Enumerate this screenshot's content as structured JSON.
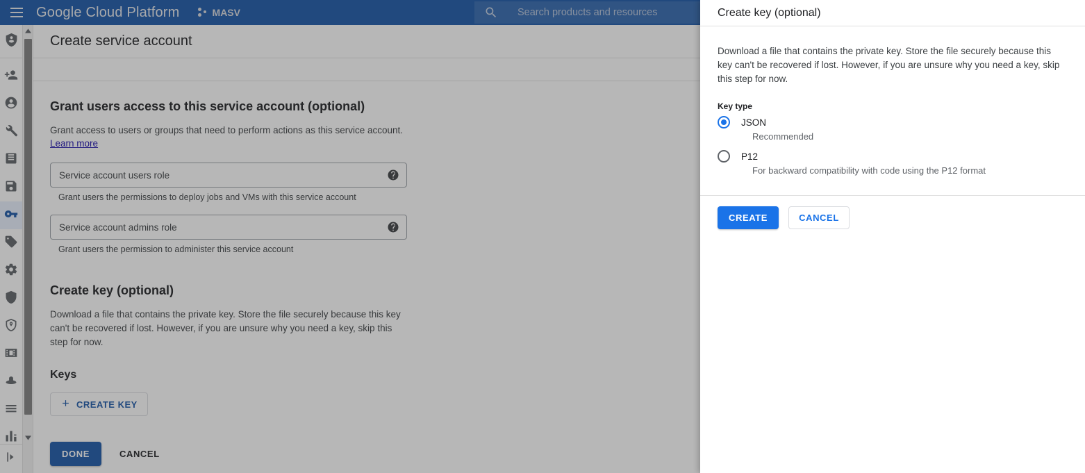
{
  "topbar": {
    "menu_icon": "hamburger-icon",
    "brand": "Google Cloud Platform",
    "project_name": "MASV",
    "project_icon": "project-dots-icon",
    "search": {
      "icon": "search-icon",
      "placeholder": "Search products and resources"
    },
    "bar_color": "#1a56a8"
  },
  "rail": {
    "top_icon": "service-account-shield-icon",
    "items": [
      {
        "name": "add-member-icon",
        "selected": false
      },
      {
        "name": "person-icon",
        "selected": false
      },
      {
        "name": "wrench-icon",
        "selected": false
      },
      {
        "name": "article-icon",
        "selected": false
      },
      {
        "name": "save-note-icon",
        "selected": false
      },
      {
        "name": "key-icon",
        "selected": true
      },
      {
        "name": "tag-icon",
        "selected": false
      },
      {
        "name": "gear-icon",
        "selected": false
      },
      {
        "name": "shield-icon",
        "selected": false
      },
      {
        "name": "location-shield-icon",
        "selected": false
      },
      {
        "name": "filmstrip-icon",
        "selected": false
      },
      {
        "name": "hat-icon",
        "selected": false
      },
      {
        "name": "list-icon",
        "selected": false
      },
      {
        "name": "chart-bars-icon",
        "selected": false
      }
    ],
    "bottom_icon": "expand-panel-icon",
    "scroll_up_icon": "caret-up-icon",
    "scroll_down_icon": "caret-down-icon"
  },
  "page": {
    "title": "Create service account",
    "grant_section": {
      "heading": "Grant users access to this service account (optional)",
      "description": "Grant access to users or groups that need to perform actions as this service account.",
      "learn_more": "Learn more",
      "fields": [
        {
          "placeholder": "Service account users role",
          "help_icon": "help-icon",
          "hint": "Grant users the permissions to deploy jobs and VMs with this service account"
        },
        {
          "placeholder": "Service account admins role",
          "help_icon": "help-icon",
          "hint": "Grant users the permission to administer this service account"
        }
      ]
    },
    "create_key_section": {
      "heading": "Create key (optional)",
      "description": "Download a file that contains the private key. Store the file securely because this key can't be recovered if lost. However, if you are unsure why you need a key, skip this step for now.",
      "keys_heading": "Keys",
      "create_key_button": "CREATE KEY",
      "create_key_icon": "plus-icon"
    },
    "footer": {
      "done_label": "DONE",
      "cancel_label": "CANCEL"
    }
  },
  "panel": {
    "title": "Create key (optional)",
    "description": "Download a file that contains the private key. Store the file securely because this key can't be recovered if lost. However, if you are unsure why you need a key, skip this step for now.",
    "key_type_label": "Key type",
    "options": [
      {
        "label": "JSON",
        "sub": "Recommended",
        "selected": true
      },
      {
        "label": "P12",
        "sub": "For backward compatibility with code using the P12 format",
        "selected": false
      }
    ],
    "create_label": "CREATE",
    "cancel_label": "CANCEL",
    "accent_color": "#1a73e8"
  }
}
